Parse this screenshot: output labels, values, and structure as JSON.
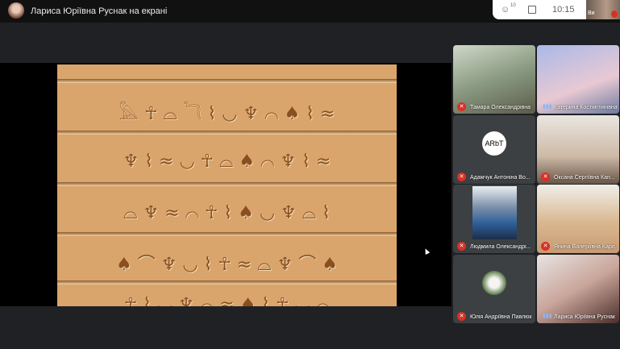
{
  "header": {
    "title": "Лариса Юріївна Руснак на екрані",
    "participants_count": "10",
    "time": "10:15",
    "self_label": "Ви"
  },
  "participants": [
    {
      "name": "Тамара Олександрівна",
      "muted": true,
      "bg": "linear-gradient(160deg,#cfd8c8,#8a9a82 50%,#5b5b4a)"
    },
    {
      "name": "Катерина Костянтинівна",
      "muted": false,
      "bg": "linear-gradient(160deg,#a9b9e8,#e8c9d3 60%,#6d7aa0)"
    },
    {
      "name": "Адамчук Антоніна Во...",
      "muted": true,
      "bg": "#3c4043",
      "avatar": "ARbT"
    },
    {
      "name": "Оксана Сергіївна Кап...",
      "muted": true,
      "bg": "linear-gradient(180deg,#e9e6e0,#cdb9a6 60%,#6a5648)"
    },
    {
      "name": "Людмила Олександрі...",
      "muted": true,
      "bg": "#3c4043"
    },
    {
      "name": "Янина Валеріївна Карп...",
      "muted": true,
      "bg": "linear-gradient(180deg,#f0eeea,#d9b890 55%,#c79a72)"
    },
    {
      "name": "Юлія Андріївна Павлюк",
      "muted": true,
      "bg": "#3c4043"
    },
    {
      "name": "Лариса Юріївна Руснак",
      "muted": false,
      "bg": "linear-gradient(150deg,#e8e4e2,#c9a59a 50%,#4a2e2a)"
    }
  ]
}
